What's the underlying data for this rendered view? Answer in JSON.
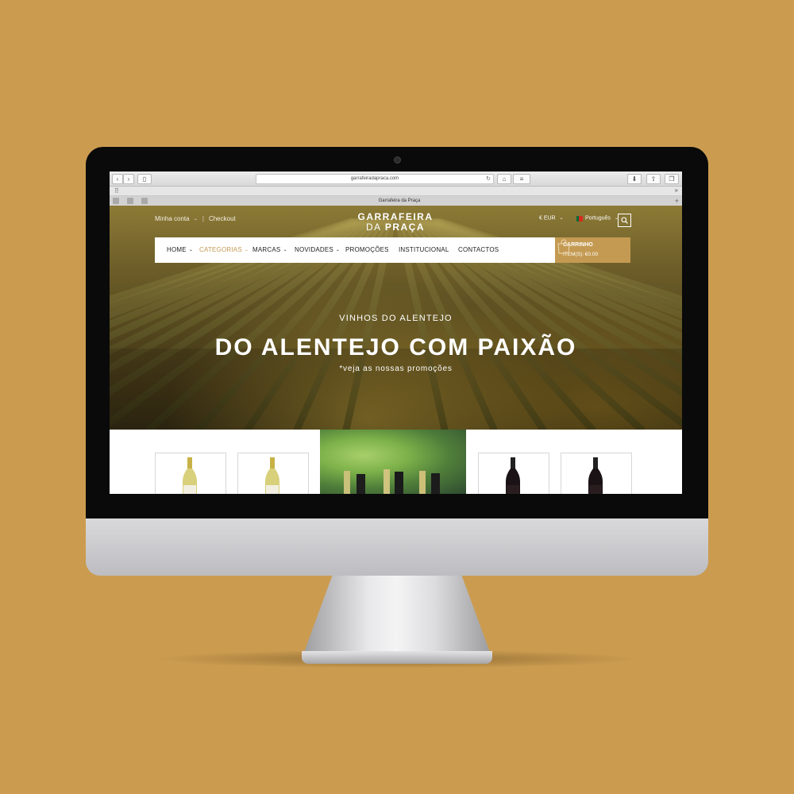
{
  "browser": {
    "url": "garrafeiradapraca.com",
    "tab_title": "Garrafeira da Praça"
  },
  "header": {
    "account": "Minha conta",
    "checkout": "Checkout",
    "logo_line1": "GARRAFEIRA",
    "logo_line2_a": "DA ",
    "logo_line2_b": "PRAÇA",
    "currency": "€ EUR",
    "language": "Português"
  },
  "nav": {
    "items": [
      {
        "label": "HOME",
        "dropdown": true
      },
      {
        "label": "CATEGORIAS",
        "dropdown": true,
        "active": true
      },
      {
        "label": "MARCAS",
        "dropdown": true
      },
      {
        "label": "NOVIDADES",
        "dropdown": true
      },
      {
        "label": "PROMOÇÕES",
        "dropdown": false
      },
      {
        "label": "INSTITUCIONAL",
        "dropdown": false
      },
      {
        "label": "CONTACTOS",
        "dropdown": false
      }
    ]
  },
  "cart": {
    "title": "CARRINHO",
    "items": "ITEM(S): €0.00"
  },
  "hero": {
    "subtitle": "VINHOS DO ALENTEJO",
    "title": "DO ALENTEJO COM PAIXÃO",
    "promo": "*veja as nossas promoções"
  },
  "colors": {
    "background": "#cb9c50",
    "accent": "#c49a52",
    "nav_text": "#222222"
  },
  "icons": {
    "search": "search-icon",
    "cart": "shopping-bag-icon",
    "caret": "chevron-down-icon"
  }
}
